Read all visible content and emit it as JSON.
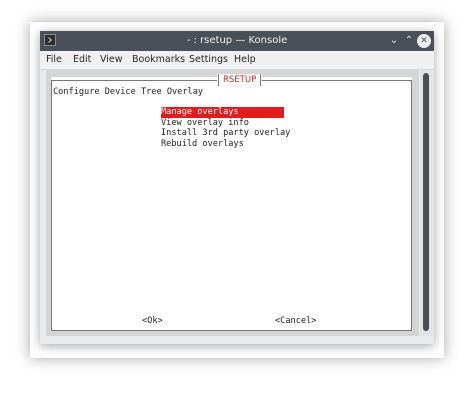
{
  "window": {
    "title": "- : rsetup — Konsole"
  },
  "menubar": [
    "File",
    "Edit",
    "View",
    "Bookmarks",
    "Settings",
    "Help"
  ],
  "dialog": {
    "title": "RSETUP",
    "heading": "Configure Device Tree Overlay",
    "items": [
      "Manage overlays",
      "View overlay info",
      "Install 3rd party overlay",
      "Rebuild overlays"
    ],
    "selected_index": 0,
    "ok_label": "<Ok>",
    "cancel_label": "<Cancel>"
  },
  "colors": {
    "accent": "#e01c1c",
    "titlebar": "#4a5057",
    "dialog_title": "#c62828"
  },
  "icons": {
    "app": "konsole-icon",
    "minimize": "chevron-down-icon",
    "maximize": "chevron-up-icon",
    "close": "close-icon"
  }
}
